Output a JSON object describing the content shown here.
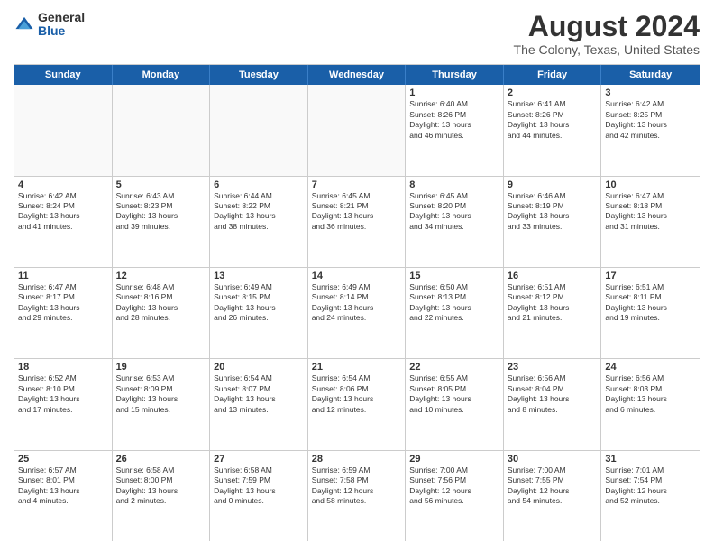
{
  "logo": {
    "general": "General",
    "blue": "Blue"
  },
  "title": "August 2024",
  "subtitle": "The Colony, Texas, United States",
  "days": [
    "Sunday",
    "Monday",
    "Tuesday",
    "Wednesday",
    "Thursday",
    "Friday",
    "Saturday"
  ],
  "weeks": [
    [
      {
        "day": "",
        "info": ""
      },
      {
        "day": "",
        "info": ""
      },
      {
        "day": "",
        "info": ""
      },
      {
        "day": "",
        "info": ""
      },
      {
        "day": "1",
        "info": "Sunrise: 6:40 AM\nSunset: 8:26 PM\nDaylight: 13 hours\nand 46 minutes."
      },
      {
        "day": "2",
        "info": "Sunrise: 6:41 AM\nSunset: 8:26 PM\nDaylight: 13 hours\nand 44 minutes."
      },
      {
        "day": "3",
        "info": "Sunrise: 6:42 AM\nSunset: 8:25 PM\nDaylight: 13 hours\nand 42 minutes."
      }
    ],
    [
      {
        "day": "4",
        "info": "Sunrise: 6:42 AM\nSunset: 8:24 PM\nDaylight: 13 hours\nand 41 minutes."
      },
      {
        "day": "5",
        "info": "Sunrise: 6:43 AM\nSunset: 8:23 PM\nDaylight: 13 hours\nand 39 minutes."
      },
      {
        "day": "6",
        "info": "Sunrise: 6:44 AM\nSunset: 8:22 PM\nDaylight: 13 hours\nand 38 minutes."
      },
      {
        "day": "7",
        "info": "Sunrise: 6:45 AM\nSunset: 8:21 PM\nDaylight: 13 hours\nand 36 minutes."
      },
      {
        "day": "8",
        "info": "Sunrise: 6:45 AM\nSunset: 8:20 PM\nDaylight: 13 hours\nand 34 minutes."
      },
      {
        "day": "9",
        "info": "Sunrise: 6:46 AM\nSunset: 8:19 PM\nDaylight: 13 hours\nand 33 minutes."
      },
      {
        "day": "10",
        "info": "Sunrise: 6:47 AM\nSunset: 8:18 PM\nDaylight: 13 hours\nand 31 minutes."
      }
    ],
    [
      {
        "day": "11",
        "info": "Sunrise: 6:47 AM\nSunset: 8:17 PM\nDaylight: 13 hours\nand 29 minutes."
      },
      {
        "day": "12",
        "info": "Sunrise: 6:48 AM\nSunset: 8:16 PM\nDaylight: 13 hours\nand 28 minutes."
      },
      {
        "day": "13",
        "info": "Sunrise: 6:49 AM\nSunset: 8:15 PM\nDaylight: 13 hours\nand 26 minutes."
      },
      {
        "day": "14",
        "info": "Sunrise: 6:49 AM\nSunset: 8:14 PM\nDaylight: 13 hours\nand 24 minutes."
      },
      {
        "day": "15",
        "info": "Sunrise: 6:50 AM\nSunset: 8:13 PM\nDaylight: 13 hours\nand 22 minutes."
      },
      {
        "day": "16",
        "info": "Sunrise: 6:51 AM\nSunset: 8:12 PM\nDaylight: 13 hours\nand 21 minutes."
      },
      {
        "day": "17",
        "info": "Sunrise: 6:51 AM\nSunset: 8:11 PM\nDaylight: 13 hours\nand 19 minutes."
      }
    ],
    [
      {
        "day": "18",
        "info": "Sunrise: 6:52 AM\nSunset: 8:10 PM\nDaylight: 13 hours\nand 17 minutes."
      },
      {
        "day": "19",
        "info": "Sunrise: 6:53 AM\nSunset: 8:09 PM\nDaylight: 13 hours\nand 15 minutes."
      },
      {
        "day": "20",
        "info": "Sunrise: 6:54 AM\nSunset: 8:07 PM\nDaylight: 13 hours\nand 13 minutes."
      },
      {
        "day": "21",
        "info": "Sunrise: 6:54 AM\nSunset: 8:06 PM\nDaylight: 13 hours\nand 12 minutes."
      },
      {
        "day": "22",
        "info": "Sunrise: 6:55 AM\nSunset: 8:05 PM\nDaylight: 13 hours\nand 10 minutes."
      },
      {
        "day": "23",
        "info": "Sunrise: 6:56 AM\nSunset: 8:04 PM\nDaylight: 13 hours\nand 8 minutes."
      },
      {
        "day": "24",
        "info": "Sunrise: 6:56 AM\nSunset: 8:03 PM\nDaylight: 13 hours\nand 6 minutes."
      }
    ],
    [
      {
        "day": "25",
        "info": "Sunrise: 6:57 AM\nSunset: 8:01 PM\nDaylight: 13 hours\nand 4 minutes."
      },
      {
        "day": "26",
        "info": "Sunrise: 6:58 AM\nSunset: 8:00 PM\nDaylight: 13 hours\nand 2 minutes."
      },
      {
        "day": "27",
        "info": "Sunrise: 6:58 AM\nSunset: 7:59 PM\nDaylight: 13 hours\nand 0 minutes."
      },
      {
        "day": "28",
        "info": "Sunrise: 6:59 AM\nSunset: 7:58 PM\nDaylight: 12 hours\nand 58 minutes."
      },
      {
        "day": "29",
        "info": "Sunrise: 7:00 AM\nSunset: 7:56 PM\nDaylight: 12 hours\nand 56 minutes."
      },
      {
        "day": "30",
        "info": "Sunrise: 7:00 AM\nSunset: 7:55 PM\nDaylight: 12 hours\nand 54 minutes."
      },
      {
        "day": "31",
        "info": "Sunrise: 7:01 AM\nSunset: 7:54 PM\nDaylight: 12 hours\nand 52 minutes."
      }
    ]
  ]
}
